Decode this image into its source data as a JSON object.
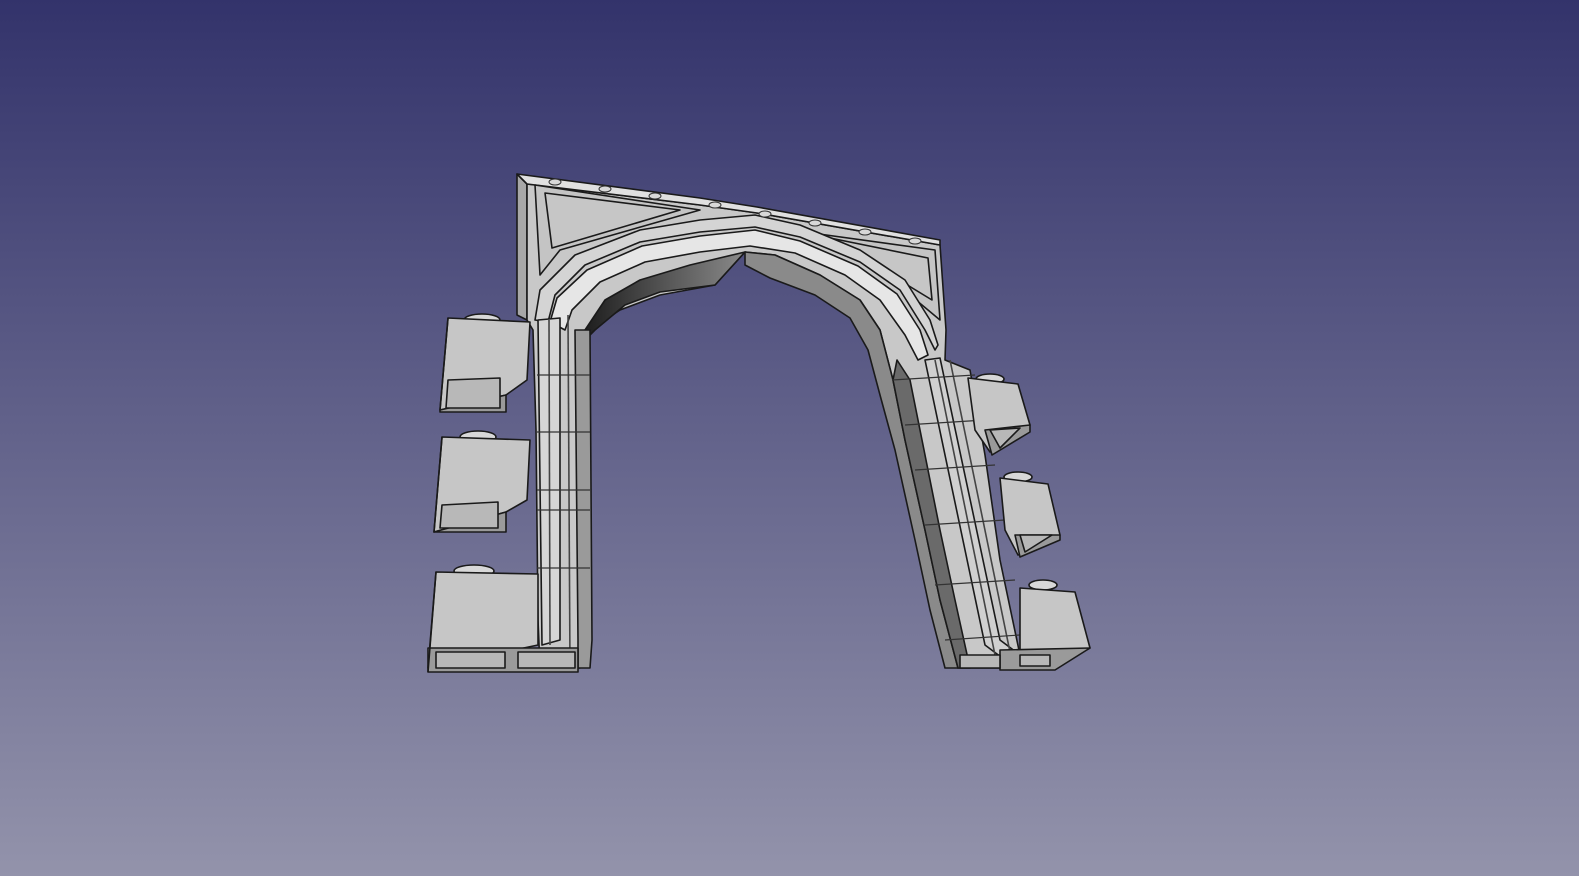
{
  "viewport": {
    "background_top": "#33336b",
    "background_bottom": "#9393ab"
  },
  "model": {
    "face_color": "#c4c4c4",
    "face_light": "#d8d8d8",
    "face_shadow": "#8a8a8a",
    "face_dark": "#555555",
    "edge_color": "#1a1a1a"
  }
}
